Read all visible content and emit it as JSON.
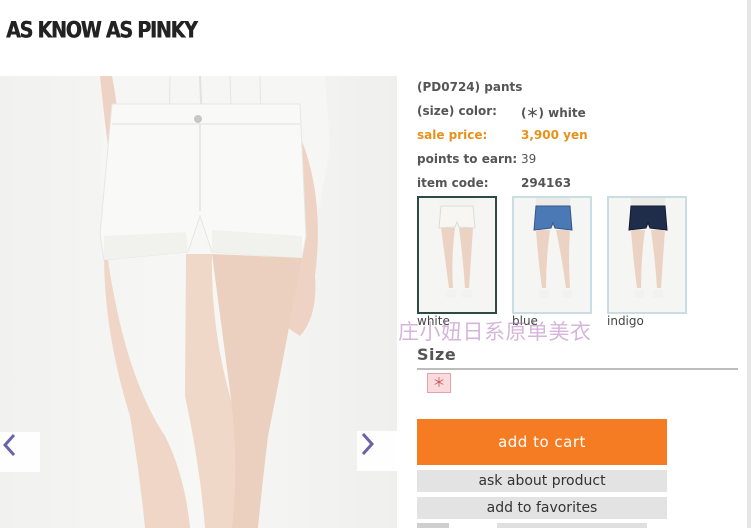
{
  "brand": {
    "logo_text": "AS KNOW AS PINKY"
  },
  "product": {
    "name": "(PD0724) pants",
    "color_label": "(size) color:",
    "color_value": "(＊) white",
    "sale_label": "sale price:",
    "sale_value": "3,900 yen",
    "points_label": "points to earn:",
    "points_value": "39",
    "code_label": "item code:",
    "code_value": "294163"
  },
  "colors": {
    "options": [
      {
        "label": "white",
        "swatch": "#f4f2ec"
      },
      {
        "label": "blue",
        "swatch": "#3e6aa3"
      },
      {
        "label": "indigo",
        "swatch": "#1d2a44"
      }
    ],
    "selected": "white",
    "accent": "#f57c23",
    "sale_text": "#e8911a"
  },
  "watermark": "庄小妞日系原单美衣",
  "size": {
    "title": "Size",
    "selected_option": "＊"
  },
  "actions": {
    "add_to_cart": "add to cart",
    "ask_about_product": "ask about product",
    "add_to_favorites": "add to favorites"
  },
  "nav": {
    "prev_icon": "chevron-left-icon",
    "next_icon": "chevron-right-icon"
  }
}
